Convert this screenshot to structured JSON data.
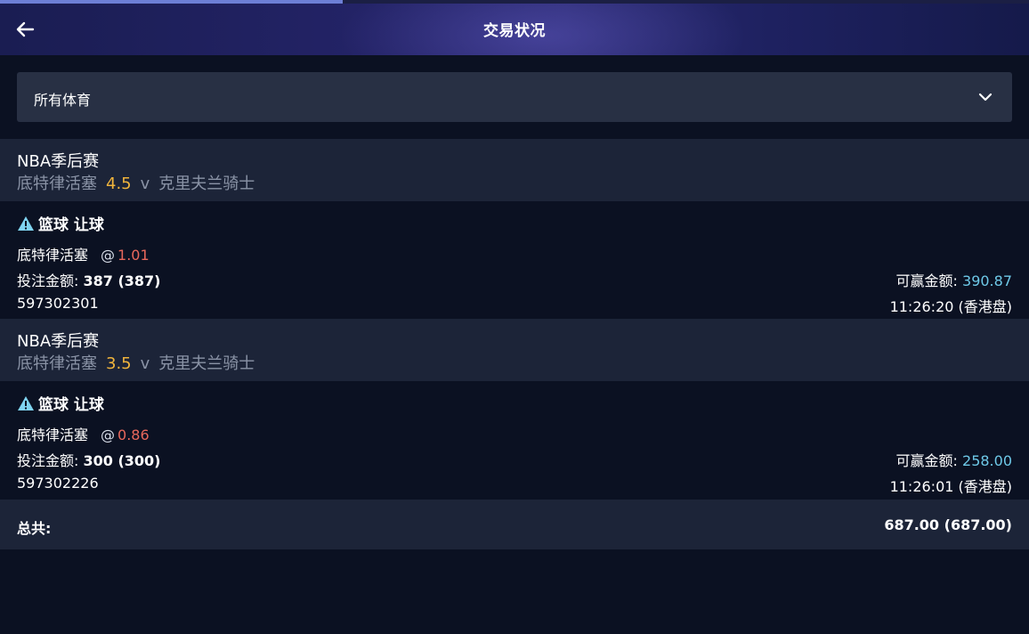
{
  "header": {
    "title": "交易状况"
  },
  "filter": {
    "selected": "所有体育"
  },
  "bets": [
    {
      "league": "NBA季后赛",
      "home": "底特律活塞",
      "line": "4.5",
      "vs": "v",
      "away": "克里夫兰骑士",
      "bet_type": "篮球 让球",
      "selection": "底特律活塞",
      "at": "@",
      "odds": "1.01",
      "stake_label": "投注金额:",
      "stake_value": "387 (387)",
      "win_label": "可赢金额:",
      "win_value": "390.87",
      "ref": "597302301",
      "time": "11:26:20 (香港盘)"
    },
    {
      "league": "NBA季后赛",
      "home": "底特律活塞",
      "line": "3.5",
      "vs": "v",
      "away": "克里夫兰骑士",
      "bet_type": "篮球 让球",
      "selection": "底特律活塞",
      "at": "@",
      "odds": "0.86",
      "stake_label": "投注金额:",
      "stake_value": "300 (300)",
      "win_label": "可赢金额:",
      "win_value": "258.00",
      "ref": "597302226",
      "time": "11:26:01 (香港盘)"
    }
  ],
  "total": {
    "label": "总共:",
    "value": "687.00 (687.00)"
  },
  "colors": {
    "accent_odds": "#e8685c",
    "accent_win": "#6ec9e8",
    "line": "#f0b43c",
    "warning_icon": "#7fd3f0"
  }
}
